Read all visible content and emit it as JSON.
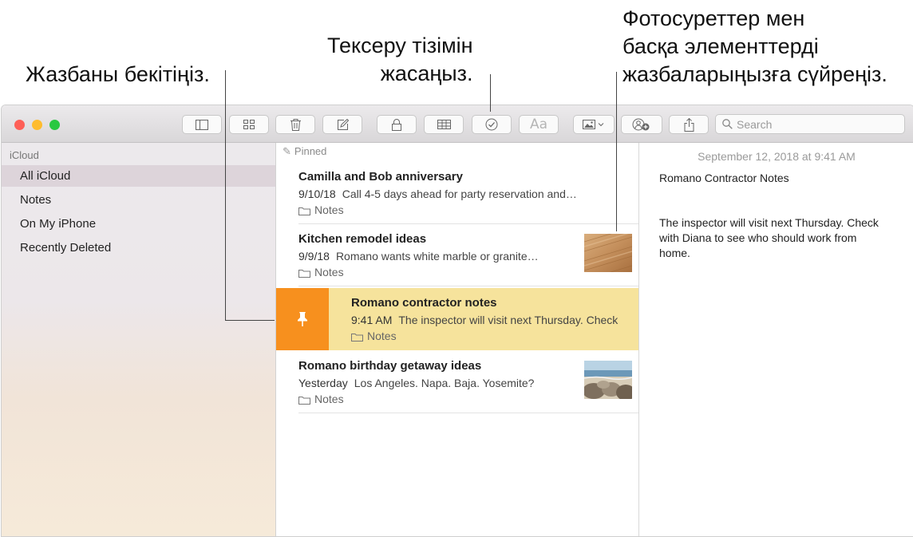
{
  "callouts": {
    "pin": [
      "Жазбаны бекітіңіз."
    ],
    "checklist": [
      "Тексеру тізімін",
      "жасаңыз."
    ],
    "drag": [
      "Фотосуреттер мен",
      "басқа элементтерді",
      "жазбаларыңызға сүйреңіз."
    ]
  },
  "toolbar": {
    "search_placeholder": "Search",
    "format_label": "Aa",
    "icons": [
      "sidebar-icon",
      "gallery-icon",
      "trash-icon",
      "compose-icon",
      "lock-icon",
      "table-icon",
      "checklist-icon",
      "format-icon",
      "media-icon",
      "collaborate-icon",
      "share-icon",
      "search-icon"
    ]
  },
  "colors": {
    "close": "#fe5f57",
    "minimize": "#febc2e",
    "zoom": "#28c840",
    "pin_action": "#f7901e",
    "selected_note": "#f6e39c"
  },
  "sidebar": {
    "header": "iCloud",
    "items": [
      "All iCloud",
      "Notes",
      "On My iPhone",
      "Recently Deleted"
    ],
    "selected": "All iCloud"
  },
  "list": {
    "pinned_label": "Pinned",
    "notes": [
      {
        "title": "Camilla and Bob anniversary",
        "date": "9/10/18",
        "preview": "Call 4-5 days ahead for party reservation and…",
        "folder": "Notes"
      },
      {
        "title": "Kitchen remodel ideas",
        "date": "9/9/18",
        "preview": "Romano wants white marble or granite…",
        "folder": "Notes"
      },
      {
        "title": "Romano contractor notes",
        "date": "9:41 AM",
        "preview": "The inspector will visit next Thursday. Check",
        "folder": "Notes"
      },
      {
        "title": "Romano birthday getaway ideas",
        "date": "Yesterday",
        "preview": "Los Angeles. Napa. Baja. Yosemite?",
        "folder": "Notes"
      }
    ]
  },
  "detail": {
    "date": "September 12, 2018 at 9:41 AM",
    "title": "Romano Contractor Notes",
    "body": "The inspector will visit next Thursday. Check with Diana to see who should work from home."
  }
}
